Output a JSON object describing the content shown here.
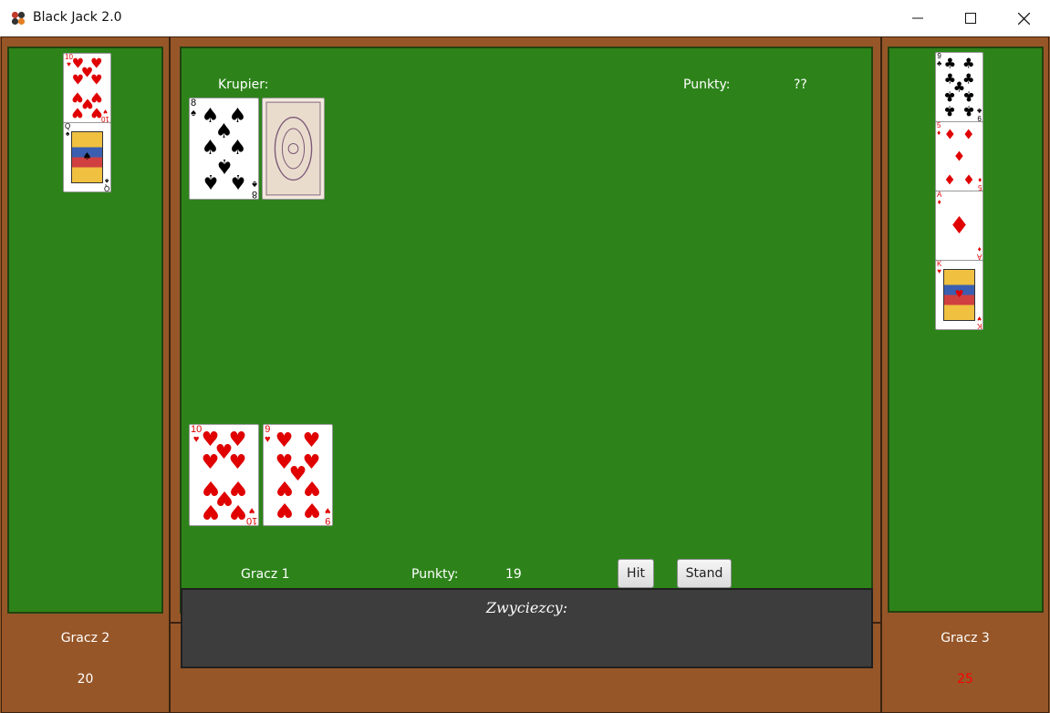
{
  "window": {
    "title": "Black Jack 2.0"
  },
  "dealer": {
    "label": "Krupier:",
    "points_label": "Punkty:",
    "points_value": "??"
  },
  "player1": {
    "name": "Gracz 1",
    "points_label": "Punkty:",
    "points_value": "19",
    "hit_label": "Hit",
    "stand_label": "Stand"
  },
  "player2": {
    "name": "Gracz 2",
    "score": "20"
  },
  "player3": {
    "name": "Gracz 3",
    "score": "25",
    "score_color": "#ff0000"
  },
  "winners": {
    "label": "Zwyciezcy:"
  },
  "cards": {
    "dealer": [
      {
        "rank": "8",
        "suit": "spades",
        "face_up": true
      },
      {
        "face_up": false
      }
    ],
    "player1": [
      {
        "rank": "10",
        "suit": "hearts",
        "face_up": true
      },
      {
        "rank": "9",
        "suit": "hearts",
        "face_up": true
      }
    ],
    "player2": [
      {
        "rank": "10",
        "suit": "hearts",
        "face_up": true
      },
      {
        "rank": "Q",
        "suit": "spades",
        "face_up": true
      }
    ],
    "player3": [
      {
        "rank": "9",
        "suit": "clubs",
        "face_up": true
      },
      {
        "rank": "5",
        "suit": "diamonds",
        "face_up": true
      },
      {
        "rank": "A",
        "suit": "diamonds",
        "face_up": true
      },
      {
        "rank": "K",
        "suit": "hearts",
        "face_up": true
      }
    ]
  },
  "colors": {
    "felt": "#2d831a",
    "wood": "#965628",
    "winner_bg": "#3d3d3d",
    "red_suit": "#e00000",
    "black_suit": "#000000"
  }
}
